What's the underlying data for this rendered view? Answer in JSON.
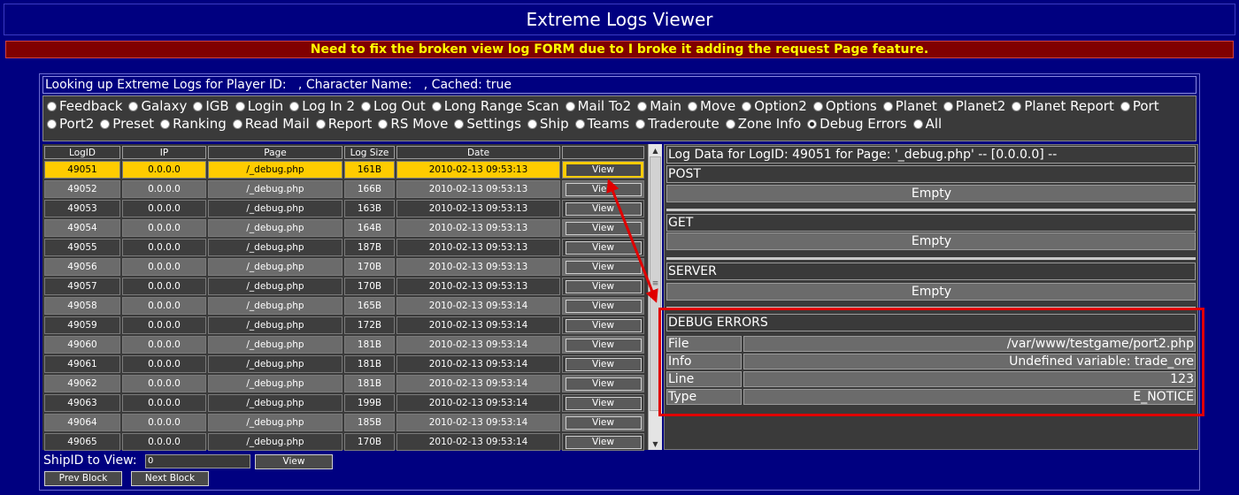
{
  "title": "Extreme Logs Viewer",
  "notice": "Need to fix the broken view log FORM due to I broke it adding the request Page feature.",
  "lookup_text": "Looking up Extreme Logs for Player ID:   , Character Name:   , Cached: true",
  "radio_options": [
    "Feedback",
    "Galaxy",
    "IGB",
    "Login",
    "Log In 2",
    "Log Out",
    "Long Range Scan",
    "Mail To2",
    "Main",
    "Move",
    "Option2",
    "Options",
    "Planet",
    "Planet2",
    "Planet Report",
    "Port",
    "Port2",
    "Preset",
    "Ranking",
    "Read Mail",
    "Report",
    "RS Move",
    "Settings",
    "Ship",
    "Teams",
    "Traderoute",
    "Zone Info",
    "Debug Errors",
    "All"
  ],
  "radio_selected": "Debug Errors",
  "table": {
    "headers": [
      "LogID",
      "IP",
      "Page",
      "Log Size",
      "Date",
      ""
    ],
    "view_label": "View",
    "rows": [
      {
        "id": "49051",
        "ip": "0.0.0.0",
        "page": "/_debug.php",
        "size": "161B",
        "date": "2010-02-13 09:53:13"
      },
      {
        "id": "49052",
        "ip": "0.0.0.0",
        "page": "/_debug.php",
        "size": "166B",
        "date": "2010-02-13 09:53:13"
      },
      {
        "id": "49053",
        "ip": "0.0.0.0",
        "page": "/_debug.php",
        "size": "163B",
        "date": "2010-02-13 09:53:13"
      },
      {
        "id": "49054",
        "ip": "0.0.0.0",
        "page": "/_debug.php",
        "size": "164B",
        "date": "2010-02-13 09:53:13"
      },
      {
        "id": "49055",
        "ip": "0.0.0.0",
        "page": "/_debug.php",
        "size": "187B",
        "date": "2010-02-13 09:53:13"
      },
      {
        "id": "49056",
        "ip": "0.0.0.0",
        "page": "/_debug.php",
        "size": "170B",
        "date": "2010-02-13 09:53:13"
      },
      {
        "id": "49057",
        "ip": "0.0.0.0",
        "page": "/_debug.php",
        "size": "170B",
        "date": "2010-02-13 09:53:13"
      },
      {
        "id": "49058",
        "ip": "0.0.0.0",
        "page": "/_debug.php",
        "size": "165B",
        "date": "2010-02-13 09:53:14"
      },
      {
        "id": "49059",
        "ip": "0.0.0.0",
        "page": "/_debug.php",
        "size": "172B",
        "date": "2010-02-13 09:53:14"
      },
      {
        "id": "49060",
        "ip": "0.0.0.0",
        "page": "/_debug.php",
        "size": "181B",
        "date": "2010-02-13 09:53:14"
      },
      {
        "id": "49061",
        "ip": "0.0.0.0",
        "page": "/_debug.php",
        "size": "181B",
        "date": "2010-02-13 09:53:14"
      },
      {
        "id": "49062",
        "ip": "0.0.0.0",
        "page": "/_debug.php",
        "size": "181B",
        "date": "2010-02-13 09:53:14"
      },
      {
        "id": "49063",
        "ip": "0.0.0.0",
        "page": "/_debug.php",
        "size": "199B",
        "date": "2010-02-13 09:53:14"
      },
      {
        "id": "49064",
        "ip": "0.0.0.0",
        "page": "/_debug.php",
        "size": "185B",
        "date": "2010-02-13 09:53:14"
      },
      {
        "id": "49065",
        "ip": "0.0.0.0",
        "page": "/_debug.php",
        "size": "170B",
        "date": "2010-02-13 09:53:14"
      }
    ]
  },
  "detail": {
    "header": "Log Data for LogID: 49051 for Page: '_debug.php' -- [0.0.0.0] --",
    "post_label": "POST",
    "post_value": "Empty",
    "get_label": "GET",
    "get_value": "Empty",
    "server_label": "SERVER",
    "server_value": "Empty",
    "debug_label": "DEBUG ERRORS",
    "debug_rows": [
      {
        "key": "File",
        "value": "/var/www/testgame/port2.php"
      },
      {
        "key": "Info",
        "value": "Undefined variable: trade_ore"
      },
      {
        "key": "Line",
        "value": "123"
      },
      {
        "key": "Type",
        "value": "E_NOTICE"
      }
    ]
  },
  "bottom": {
    "ship_label": "ShipID to View:",
    "ship_value": "0",
    "view_label": "View",
    "prev_label": "Prev Block",
    "next_label": "Next Block"
  },
  "colors": {
    "background": "#000080",
    "notice_bg": "#800000",
    "notice_text": "#ffff00",
    "selected_row": "#ffcc00",
    "annotation": "#e00000"
  }
}
